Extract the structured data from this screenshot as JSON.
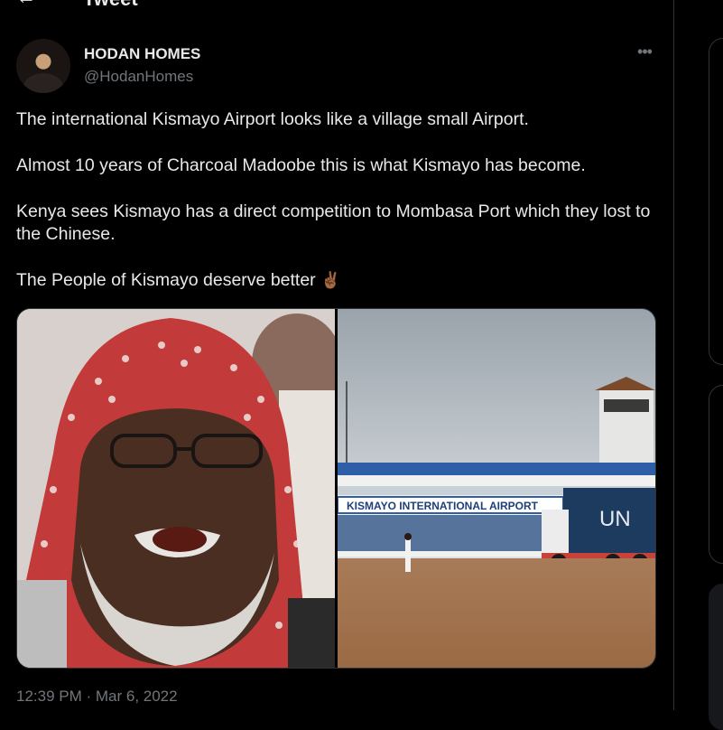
{
  "header": {
    "title": "Tweet",
    "back_icon": "back-arrow-icon"
  },
  "tweet": {
    "display_name": "HODAN HOMES",
    "handle": "@HodanHomes",
    "more_icon": "more-horizontal-icon",
    "paragraphs": [
      "The international Kismayo Airport looks like a village small Airport.",
      "Almost 10 years of Charcoal Madoobe this is what Kismayo has become.",
      "Kenya sees Kismayo has a direct competition to Mombasa Port which they lost to the Chinese.",
      "The People of Kismayo deserve better"
    ],
    "emoji": "✌🏾",
    "media": {
      "right_sign": "KISMAYO INTERNATIONAL AIRPORT",
      "container_label": "UN"
    },
    "timestamp": "12:39 PM · Mar 6, 2022"
  },
  "colors": {
    "background": "#000000",
    "text_primary": "#e7e9ea",
    "text_secondary": "#71767b",
    "divider": "#2f3336"
  }
}
